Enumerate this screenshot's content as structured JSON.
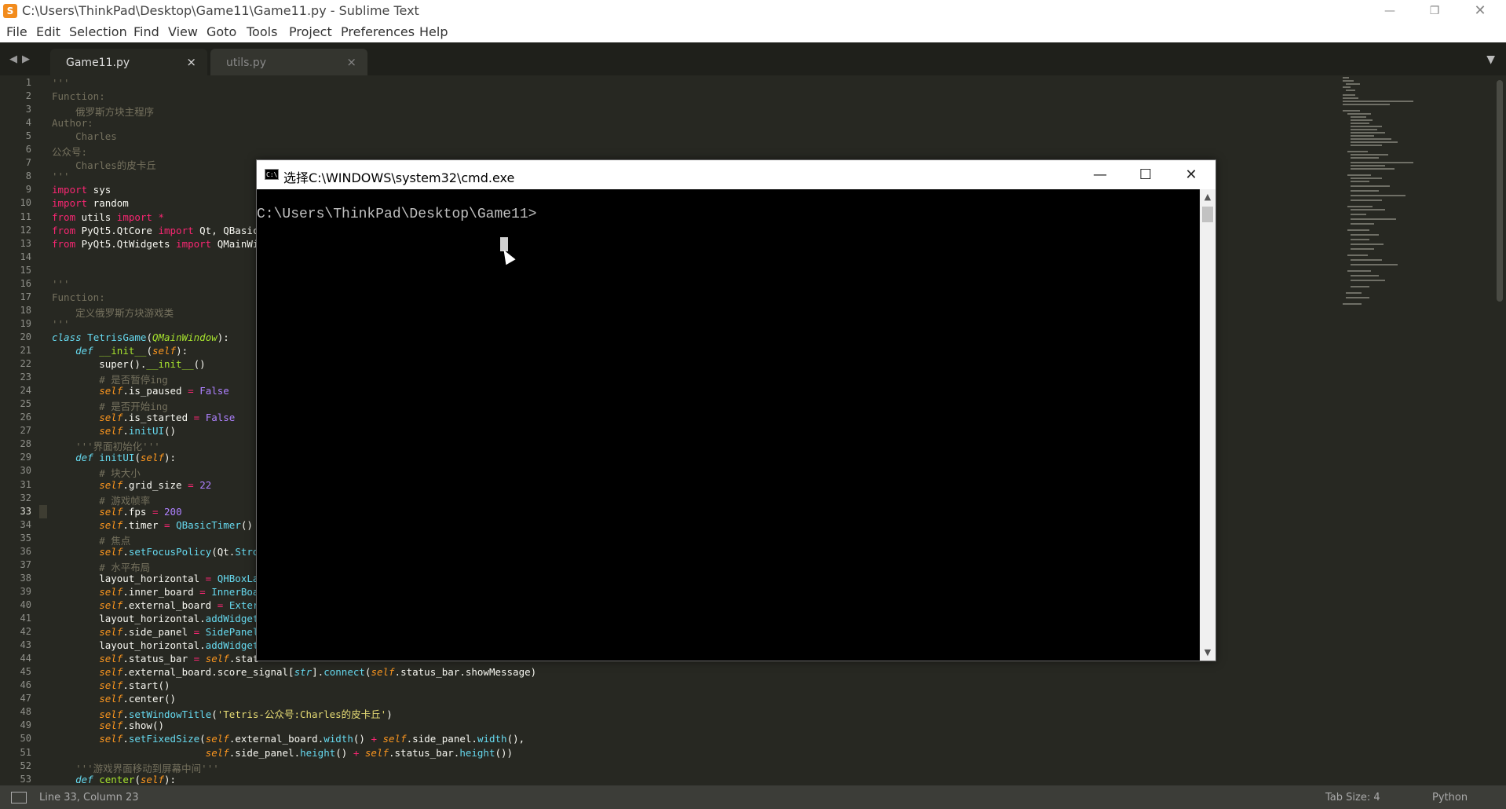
{
  "window": {
    "title": "C:\\Users\\ThinkPad\\Desktop\\Game11\\Game11.py - Sublime Text",
    "app_icon": "sublime-logo",
    "controls": [
      "minimize",
      "restore",
      "close"
    ]
  },
  "menu": [
    "File",
    "Edit",
    "Selection",
    "Find",
    "View",
    "Goto",
    "Tools",
    "Project",
    "Preferences",
    "Help"
  ],
  "tabs": [
    {
      "label": "Game11.py",
      "close": "×"
    },
    {
      "label": "utils.py",
      "close": "×"
    }
  ],
  "editor": {
    "line_numbers": [
      "1",
      "2",
      "3",
      "4",
      "5",
      "6",
      "7",
      "8",
      "9",
      "10",
      "11",
      "12",
      "13",
      "14",
      "15",
      "16",
      "17",
      "18",
      "19",
      "20",
      "21",
      "22",
      "23",
      "24",
      "25",
      "26",
      "27",
      "28",
      "29",
      "30",
      "31",
      "32",
      "33",
      "34",
      "35",
      "36",
      "37",
      "38",
      "39",
      "40",
      "41",
      "42",
      "43",
      "44",
      "45",
      "46",
      "47",
      "48",
      "49",
      "50",
      "51",
      "52",
      "53"
    ],
    "current_line": 33,
    "lines": [
      "'''",
      "Function:",
      "    俄罗斯方块主程序",
      "Author:",
      "    Charles",
      "公众号:",
      "    Charles的皮卡丘",
      "'''",
      "import sys",
      "import random",
      "from utils import *",
      "from PyQt5.QtCore import Qt, QBasic",
      "from PyQt5.QtWidgets import QMainWi",
      "",
      "",
      "'''",
      "Function:",
      "    定义俄罗斯方块游戏类",
      "'''",
      "class TetrisGame(QMainWindow):",
      "    def __init__(self):",
      "        super().__init__()",
      "        # 是否暂停ing",
      "        self.is_paused = False",
      "        # 是否开始ing",
      "        self.is_started = False",
      "        self.initUI()",
      "    '''界面初始化'''",
      "    def initUI(self):",
      "        # 块大小",
      "        self.grid_size = 22",
      "        # 游戏帧率",
      "        self.fps = 200",
      "        self.timer = QBasicTimer()",
      "        # 焦点",
      "        self.setFocusPolicy(Qt.Stro",
      "        # 水平布局",
      "        layout_horizontal = QHBoxLa",
      "        self.inner_board = InnerBoa",
      "        self.external_board = Exter",
      "        layout_horizontal.addWidget",
      "        self.side_panel = SidePanel",
      "        layout_horizontal.addWidget",
      "        self.status_bar = self.stat",
      "        self.external_board.score_signal[str].connect(self.status_bar.showMessage)",
      "        self.start()",
      "        self.center()",
      "        self.setWindowTitle('Tetris-公众号:Charles的皮卡丘')",
      "        self.show()",
      "        self.setFixedSize(self.external_board.width() + self.side_panel.width(),",
      "                          self.side_panel.height() + self.status_bar.height())",
      "    '''游戏界面移动到屏幕中间'''",
      "    def center(self):"
    ]
  },
  "status": {
    "position": "Line 33, Column 23",
    "tab_size": "Tab Size: 4",
    "syntax": "Python"
  },
  "cmd": {
    "title": "选择C:\\WINDOWS\\system32\\cmd.exe",
    "prompt": "C:\\Users\\ThinkPad\\Desktop\\Game11>"
  },
  "colors": {
    "editor_bg": "#272822",
    "keyword": "#f92672",
    "comment": "#75715e",
    "function": "#66d9ef",
    "self": "#fd971f",
    "number": "#ae81ff",
    "string": "#e6db74"
  }
}
